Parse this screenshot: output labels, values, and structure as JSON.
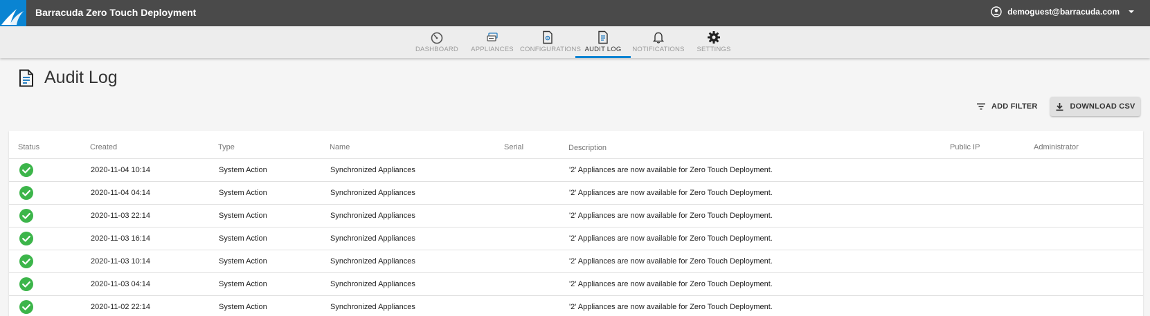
{
  "app": {
    "title": "Barracuda Zero Touch Deployment",
    "brand_color": "#0a84d2",
    "user_email": "demoguest@barracuda.com"
  },
  "nav": [
    {
      "id": "dashboard",
      "label": "DASHBOARD",
      "icon": "gauge-icon"
    },
    {
      "id": "appliances",
      "label": "APPLIANCES",
      "icon": "appliances-icon"
    },
    {
      "id": "configurations",
      "label": "CONFIGURATIONS",
      "icon": "config-file-icon"
    },
    {
      "id": "audit-log",
      "label": "AUDIT LOG",
      "icon": "document-icon",
      "active": true
    },
    {
      "id": "notifications",
      "label": "NOTIFICATIONS",
      "icon": "bell-icon"
    },
    {
      "id": "settings",
      "label": "SETTINGS",
      "icon": "gear-icon"
    }
  ],
  "page": {
    "title": "Audit Log",
    "add_filter": "ADD FILTER",
    "download_csv": "DOWNLOAD CSV"
  },
  "table": {
    "columns": [
      "Status",
      "Created",
      "Type",
      "Name",
      "Serial",
      "Description",
      "Public IP",
      "Administrator"
    ],
    "rows": [
      {
        "status": "success",
        "created": "2020-11-04 10:14",
        "type": "System Action",
        "name": "Synchronized Appliances",
        "serial": "",
        "description": "'2' Appliances are now available for Zero Touch Deployment.",
        "public_ip": "",
        "administrator": ""
      },
      {
        "status": "success",
        "created": "2020-11-04 04:14",
        "type": "System Action",
        "name": "Synchronized Appliances",
        "serial": "",
        "description": "'2' Appliances are now available for Zero Touch Deployment.",
        "public_ip": "",
        "administrator": ""
      },
      {
        "status": "success",
        "created": "2020-11-03 22:14",
        "type": "System Action",
        "name": "Synchronized Appliances",
        "serial": "",
        "description": "'2' Appliances are now available for Zero Touch Deployment.",
        "public_ip": "",
        "administrator": ""
      },
      {
        "status": "success",
        "created": "2020-11-03 16:14",
        "type": "System Action",
        "name": "Synchronized Appliances",
        "serial": "",
        "description": "'2' Appliances are now available for Zero Touch Deployment.",
        "public_ip": "",
        "administrator": ""
      },
      {
        "status": "success",
        "created": "2020-11-03 10:14",
        "type": "System Action",
        "name": "Synchronized Appliances",
        "serial": "",
        "description": "'2' Appliances are now available for Zero Touch Deployment.",
        "public_ip": "",
        "administrator": ""
      },
      {
        "status": "success",
        "created": "2020-11-03 04:14",
        "type": "System Action",
        "name": "Synchronized Appliances",
        "serial": "",
        "description": "'2' Appliances are now available for Zero Touch Deployment.",
        "public_ip": "",
        "administrator": ""
      },
      {
        "status": "success",
        "created": "2020-11-02 22:14",
        "type": "System Action",
        "name": "Synchronized Appliances",
        "serial": "",
        "description": "'2' Appliances are now available for Zero Touch Deployment.",
        "public_ip": "",
        "administrator": ""
      }
    ]
  },
  "colors": {
    "topbar": "#4a4a4a",
    "success": "#3cb54a",
    "active_tab": "#0a84d2"
  }
}
